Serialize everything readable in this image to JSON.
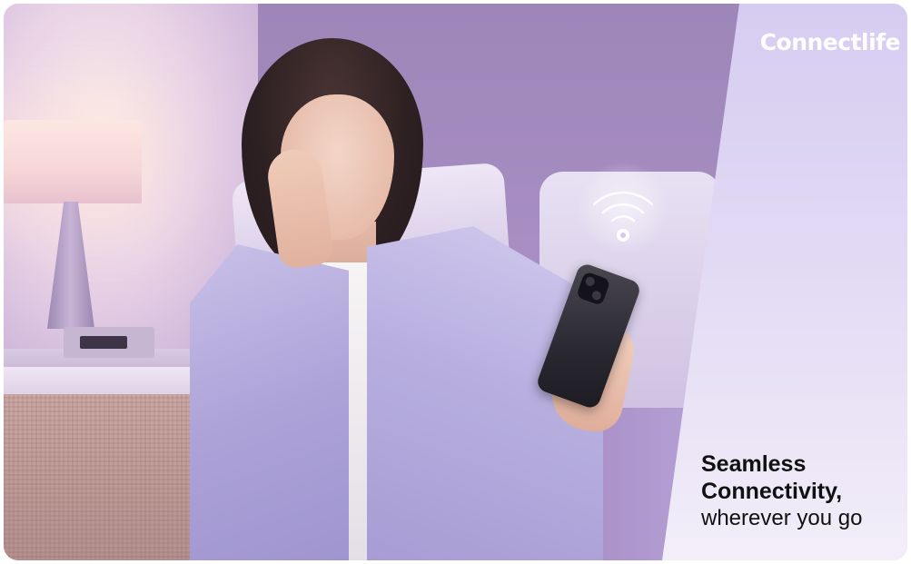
{
  "brand": {
    "name": "Connectlife"
  },
  "headline": {
    "line1": "Seamless",
    "line2": "Connectivity,",
    "line3": "wherever you go"
  },
  "colors": {
    "background_purple": "#a58bc3",
    "panel_lavender": "#e0d8f4",
    "brand_text": "#ffffff",
    "headline_text": "#111111"
  },
  "icons": [
    "wifi-signal-icon"
  ]
}
